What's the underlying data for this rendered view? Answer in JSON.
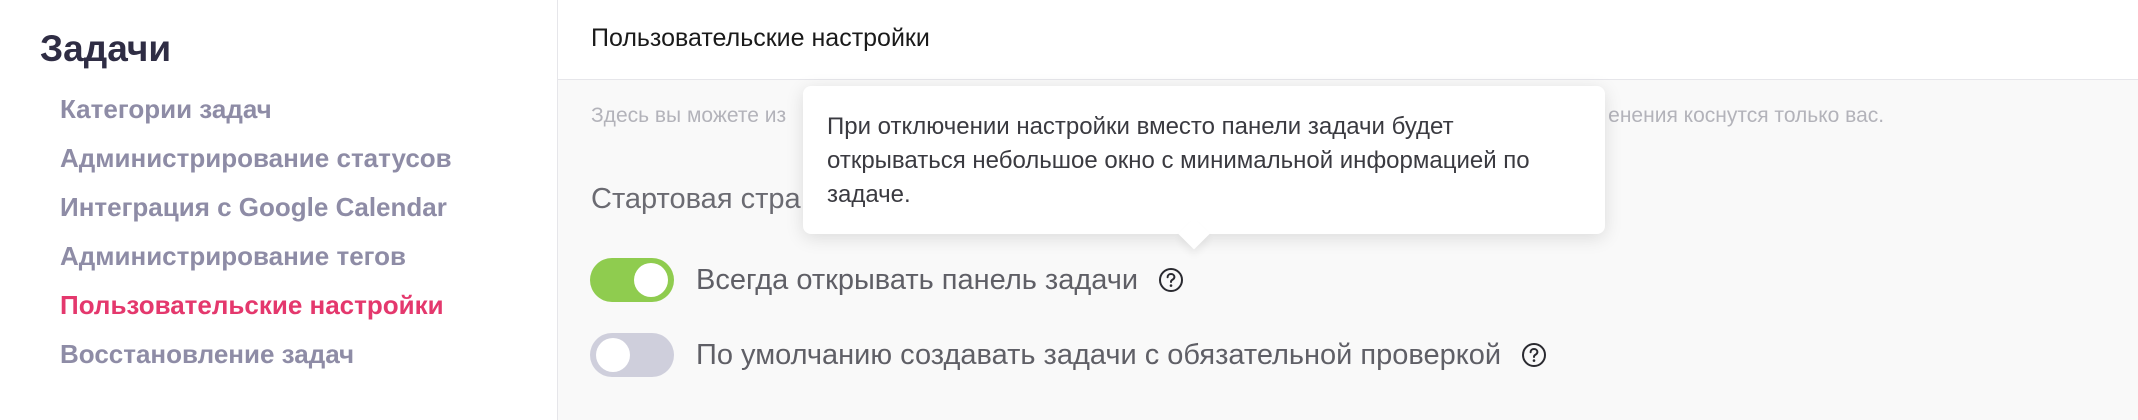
{
  "sidebar": {
    "title": "Задачи",
    "items": [
      {
        "label": "Категории задач",
        "active": false
      },
      {
        "label": "Администрирование статусов",
        "active": false
      },
      {
        "label": "Интеграция с Google Calendar",
        "active": false
      },
      {
        "label": "Администрирование тегов",
        "active": false
      },
      {
        "label": "Пользовательские настройки",
        "active": true
      },
      {
        "label": "Восстановление задач",
        "active": false
      }
    ]
  },
  "main": {
    "title": "Пользовательские настройки",
    "description_start": "Здесь вы можете из",
    "description_end": "енения коснутся только вас.",
    "section_label": "Стартовая стра",
    "settings": [
      {
        "label": "Всегда открывать панель задачи",
        "enabled": true,
        "help_icon": "question-circle-icon"
      },
      {
        "label": "По умолчанию создавать задачи с обязательной проверкой",
        "enabled": false,
        "help_icon": "question-circle-icon"
      }
    ],
    "tooltip": {
      "text": "При отключении настройки вместо панели задачи будет открываться небольшое окно с минимальной информацией по задаче."
    }
  },
  "colors": {
    "active_nav": "#e4386d",
    "nav_text": "#8e8ca6",
    "toggle_on": "#8fcc4f",
    "toggle_off": "#cfcfdc"
  }
}
